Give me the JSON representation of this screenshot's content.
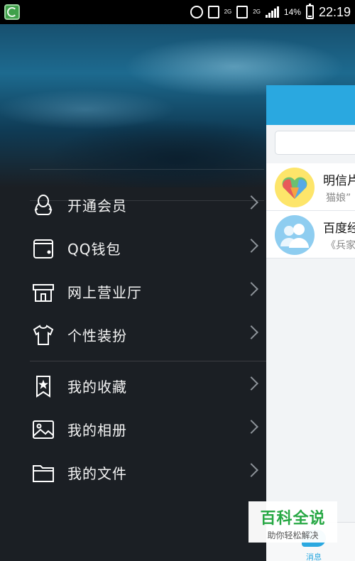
{
  "status_bar": {
    "signal_label": "2G",
    "data_label": "2G",
    "battery_percent": "14%",
    "battery_level": 0.14,
    "time": "22:19"
  },
  "drawer": {
    "items": [
      {
        "label": "开通会员",
        "icon": "penguin-icon"
      },
      {
        "label": "QQ钱包",
        "icon": "wallet-icon"
      },
      {
        "label": "网上营业厅",
        "icon": "store-icon"
      },
      {
        "label": "个性装扮",
        "icon": "tshirt-icon"
      },
      {
        "label": "我的收藏",
        "icon": "bookmark-star-icon"
      },
      {
        "label": "我的相册",
        "icon": "picture-icon"
      },
      {
        "label": "我的文件",
        "icon": "folder-icon"
      }
    ]
  },
  "main": {
    "conversations": [
      {
        "title": "明信片",
        "subtitle": "猫娘”"
      },
      {
        "title": "百度经",
        "subtitle": "《兵家"
      }
    ],
    "bottom_tab_label": "消息"
  },
  "watermark": {
    "title": "百科全说",
    "subtitle": "助你轻松解决"
  },
  "colors": {
    "accent": "#2aa8e0",
    "drawer_bg": "#1b1f24",
    "watermark_green": "#27a844"
  }
}
